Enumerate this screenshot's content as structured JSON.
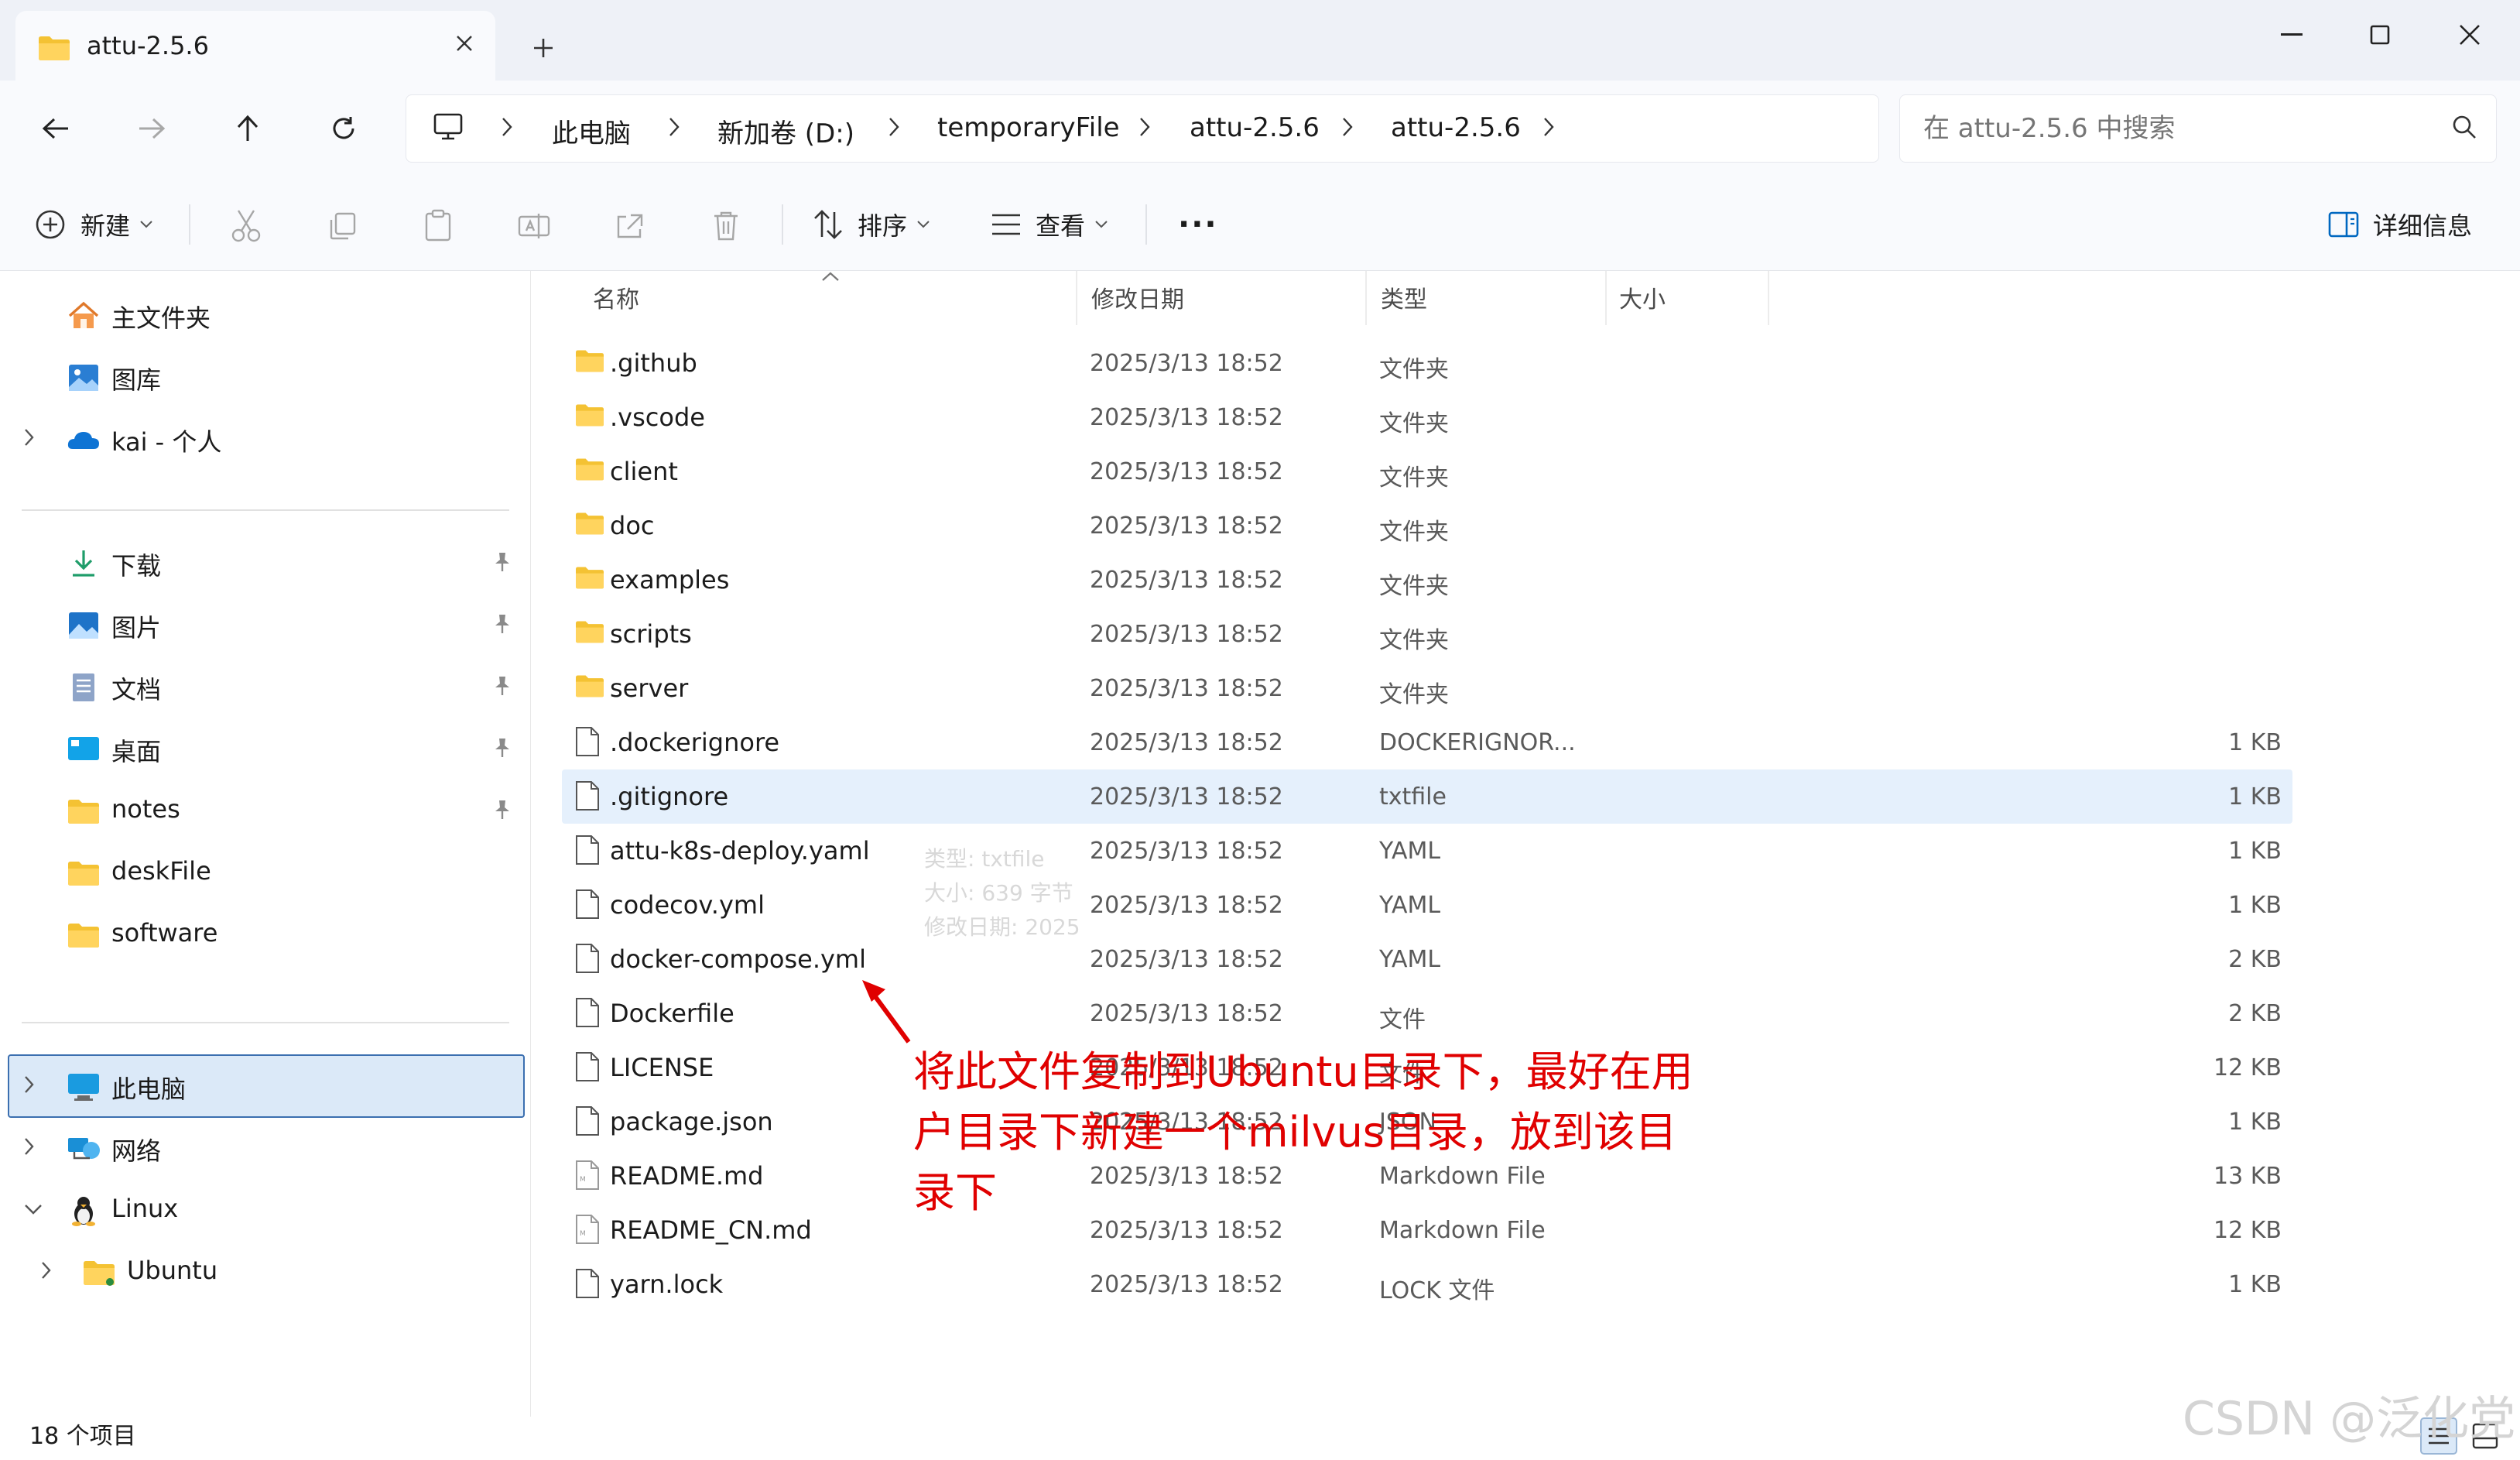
{
  "window": {
    "tab_title": "attu-2.5.6",
    "new_tab_symbol": "+",
    "close_tab_symbol": "✕"
  },
  "address": {
    "segments": [
      "此电脑",
      "新加卷 (D:)",
      "temporaryFile",
      "attu-2.5.6",
      "attu-2.5.6"
    ],
    "separator": "›"
  },
  "search": {
    "placeholder": "在 attu-2.5.6 中搜索"
  },
  "toolbar": {
    "new_label": "新建",
    "sort_label": "排序",
    "view_label": "查看",
    "more_label": "···",
    "details_label": "详细信息"
  },
  "sidebar": {
    "quick": [
      {
        "label": "主文件夹",
        "icon": "home-icon"
      },
      {
        "label": "图库",
        "icon": "gallery-icon"
      },
      {
        "label": "kai - 个人",
        "icon": "cloud-icon"
      }
    ],
    "pinned": [
      {
        "label": "下载",
        "icon": "download-icon"
      },
      {
        "label": "图片",
        "icon": "pictures-icon"
      },
      {
        "label": "文档",
        "icon": "documents-icon"
      },
      {
        "label": "桌面",
        "icon": "desktop-icon"
      },
      {
        "label": "notes",
        "icon": "folder-icon"
      },
      {
        "label": "deskFile",
        "icon": "folder-icon"
      },
      {
        "label": "software",
        "icon": "folder-icon"
      }
    ],
    "devices": [
      {
        "label": "此电脑",
        "icon": "computer-icon"
      },
      {
        "label": "网络",
        "icon": "network-icon"
      },
      {
        "label": "Linux",
        "icon": "linux-icon"
      },
      {
        "label": "Ubuntu",
        "icon": "folder-icon"
      }
    ]
  },
  "columns": {
    "name": "名称",
    "date": "修改日期",
    "type": "类型",
    "size": "大小"
  },
  "files": [
    {
      "name": ".github",
      "date": "2025/3/13 18:52",
      "type": "文件夹",
      "size": "",
      "kind": "folder"
    },
    {
      "name": ".vscode",
      "date": "2025/3/13 18:52",
      "type": "文件夹",
      "size": "",
      "kind": "folder"
    },
    {
      "name": "client",
      "date": "2025/3/13 18:52",
      "type": "文件夹",
      "size": "",
      "kind": "folder"
    },
    {
      "name": "doc",
      "date": "2025/3/13 18:52",
      "type": "文件夹",
      "size": "",
      "kind": "folder"
    },
    {
      "name": "examples",
      "date": "2025/3/13 18:52",
      "type": "文件夹",
      "size": "",
      "kind": "folder"
    },
    {
      "name": "scripts",
      "date": "2025/3/13 18:52",
      "type": "文件夹",
      "size": "",
      "kind": "folder"
    },
    {
      "name": "server",
      "date": "2025/3/13 18:52",
      "type": "文件夹",
      "size": "",
      "kind": "folder"
    },
    {
      "name": ".dockerignore",
      "date": "2025/3/13 18:52",
      "type": "DOCKERIGNOR...",
      "size": "1 KB",
      "kind": "file"
    },
    {
      "name": ".gitignore",
      "date": "2025/3/13 18:52",
      "type": "txtfile",
      "size": "1 KB",
      "kind": "file"
    },
    {
      "name": "attu-k8s-deploy.yaml",
      "date": "2025/3/13 18:52",
      "type": "YAML",
      "size": "1 KB",
      "kind": "file"
    },
    {
      "name": "codecov.yml",
      "date": "2025/3/13 18:52",
      "type": "YAML",
      "size": "1 KB",
      "kind": "file"
    },
    {
      "name": "docker-compose.yml",
      "date": "2025/3/13 18:52",
      "type": "YAML",
      "size": "2 KB",
      "kind": "file"
    },
    {
      "name": "Dockerfile",
      "date": "2025/3/13 18:52",
      "type": "文件",
      "size": "2 KB",
      "kind": "file"
    },
    {
      "name": "LICENSE",
      "date": "2025/3/13 18:52",
      "type": "文件",
      "size": "12 KB",
      "kind": "file"
    },
    {
      "name": "package.json",
      "date": "2025/3/13 18:52",
      "type": "JSON",
      "size": "1 KB",
      "kind": "file"
    },
    {
      "name": "README.md",
      "date": "2025/3/13 18:52",
      "type": "Markdown File",
      "size": "13 KB",
      "kind": "md"
    },
    {
      "name": "README_CN.md",
      "date": "2025/3/13 18:52",
      "type": "Markdown File",
      "size": "12 KB",
      "kind": "md"
    },
    {
      "name": "yarn.lock",
      "date": "2025/3/13 18:52",
      "type": "LOCK 文件",
      "size": "1 KB",
      "kind": "file"
    }
  ],
  "tooltip": {
    "line1": "类型: txtfile",
    "line2": "大小: 639 字节",
    "line3": "修改日期: 2025"
  },
  "annotation": "将此文件复制到Ubuntu目录下，最好在用户目录下新建一个milvus目录，放到该目录下",
  "status": {
    "count": "18 个项目"
  },
  "watermark": "CSDN @泛化党",
  "colors": {
    "folder": "#f4c233",
    "accent": "#0067c0",
    "selection": "#e5f0fc",
    "annotation": "#e00000"
  }
}
